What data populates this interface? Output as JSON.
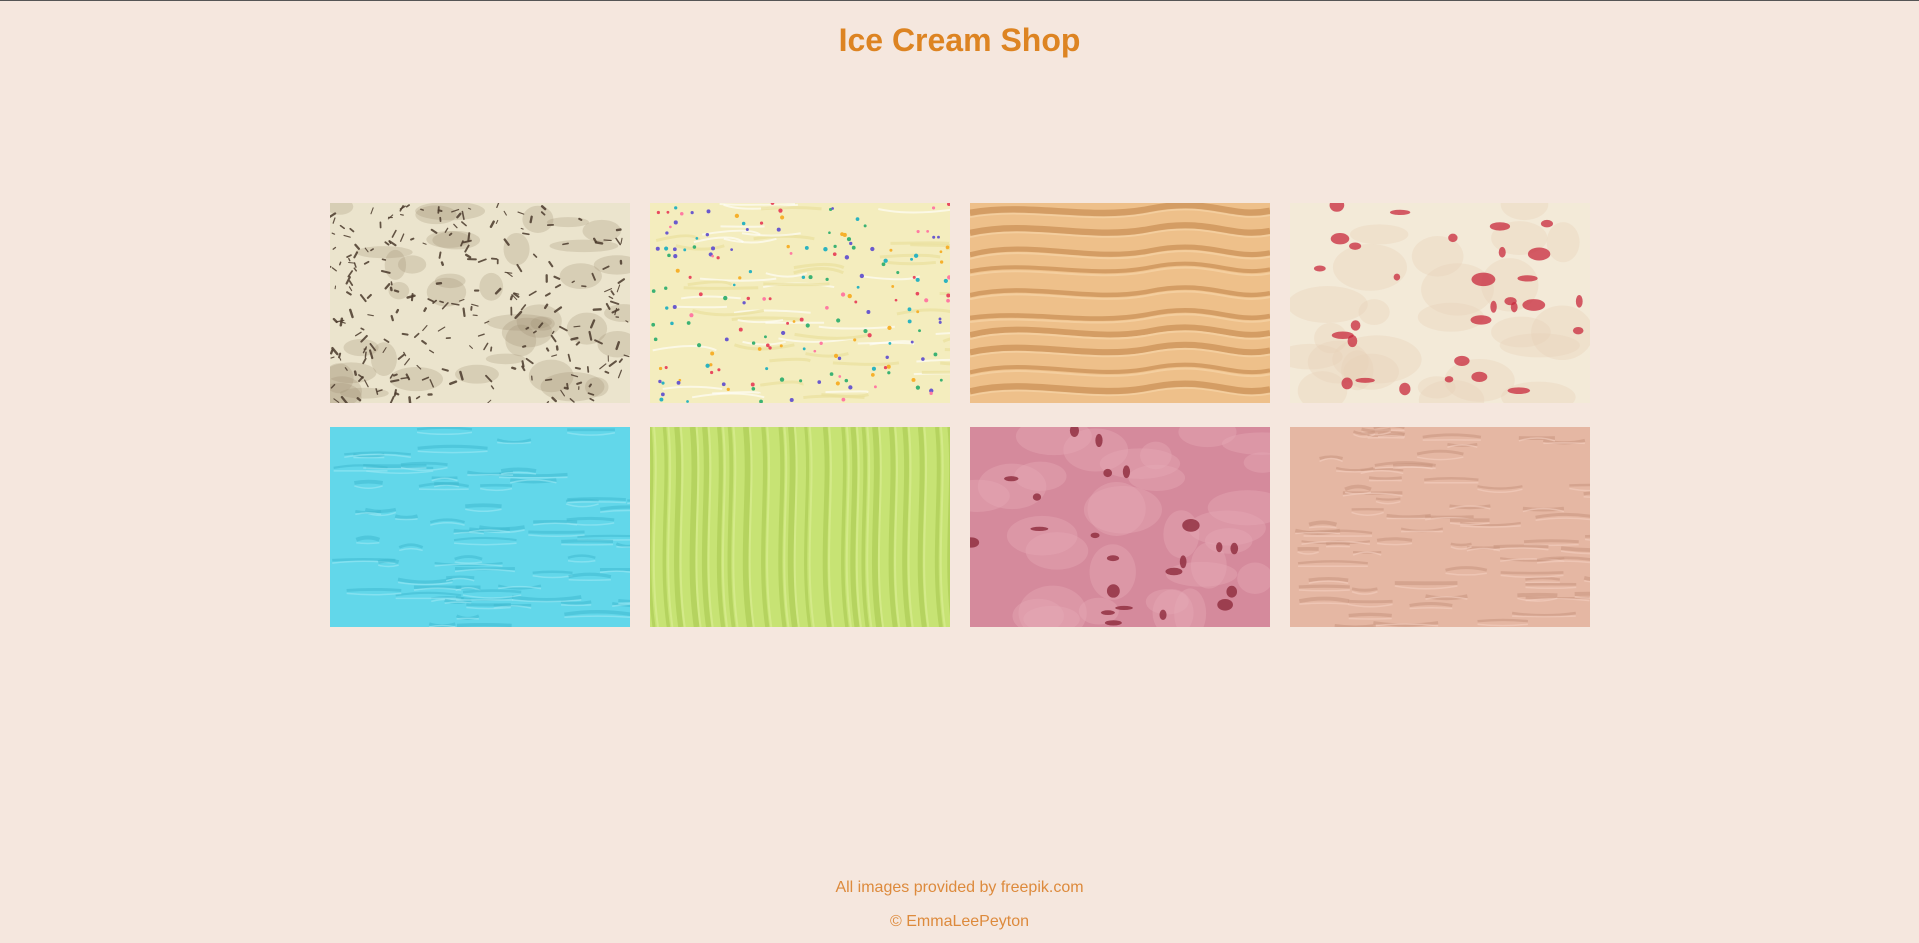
{
  "header": {
    "title": "Ice Cream Shop"
  },
  "gallery": {
    "items": [
      {
        "icon": "stracciatella-ice-cream-image",
        "base": "#ebe4cd",
        "accent": "#4b3a2c",
        "accent2": "#9a8a70",
        "texture": "flecks"
      },
      {
        "icon": "sprinkles-vanilla-ice-cream-image",
        "base": "#f4edbe",
        "accent": "#e9df9d",
        "accent2": "#ffffff",
        "texture": "sprinkles"
      },
      {
        "icon": "caramel-ice-cream-image",
        "base": "#eec08a",
        "accent": "#c98f54",
        "accent2": "#f7d4a6",
        "texture": "waves"
      },
      {
        "icon": "cherry-vanilla-ice-cream-image",
        "base": "#f3ead8",
        "accent": "#c8283c",
        "accent2": "#e9d2b6",
        "texture": "swirl"
      },
      {
        "icon": "blue-ice-cream-image",
        "base": "#62d7ea",
        "accent": "#3fb9d0",
        "accent2": "#9be8f4",
        "texture": "ridges"
      },
      {
        "icon": "pistachio-ice-cream-image",
        "base": "#c7e374",
        "accent": "#a6c64e",
        "accent2": "#dff09b",
        "texture": "streaks"
      },
      {
        "icon": "strawberry-ice-cream-image",
        "base": "#d58a9c",
        "accent": "#8d2b3c",
        "accent2": "#e6aab7",
        "texture": "chunks"
      },
      {
        "icon": "chocolate-milk-ice-cream-image",
        "base": "#e5b7a3",
        "accent": "#c89580",
        "accent2": "#f3cfc0",
        "texture": "ridges"
      }
    ]
  },
  "footer": {
    "credit": "All images provided by freepik.com",
    "copyright": "© EmmaLeePeyton"
  },
  "colors": {
    "background": "#f5e7de",
    "title": "#dd8422",
    "footer_text": "#dd8a3c"
  }
}
